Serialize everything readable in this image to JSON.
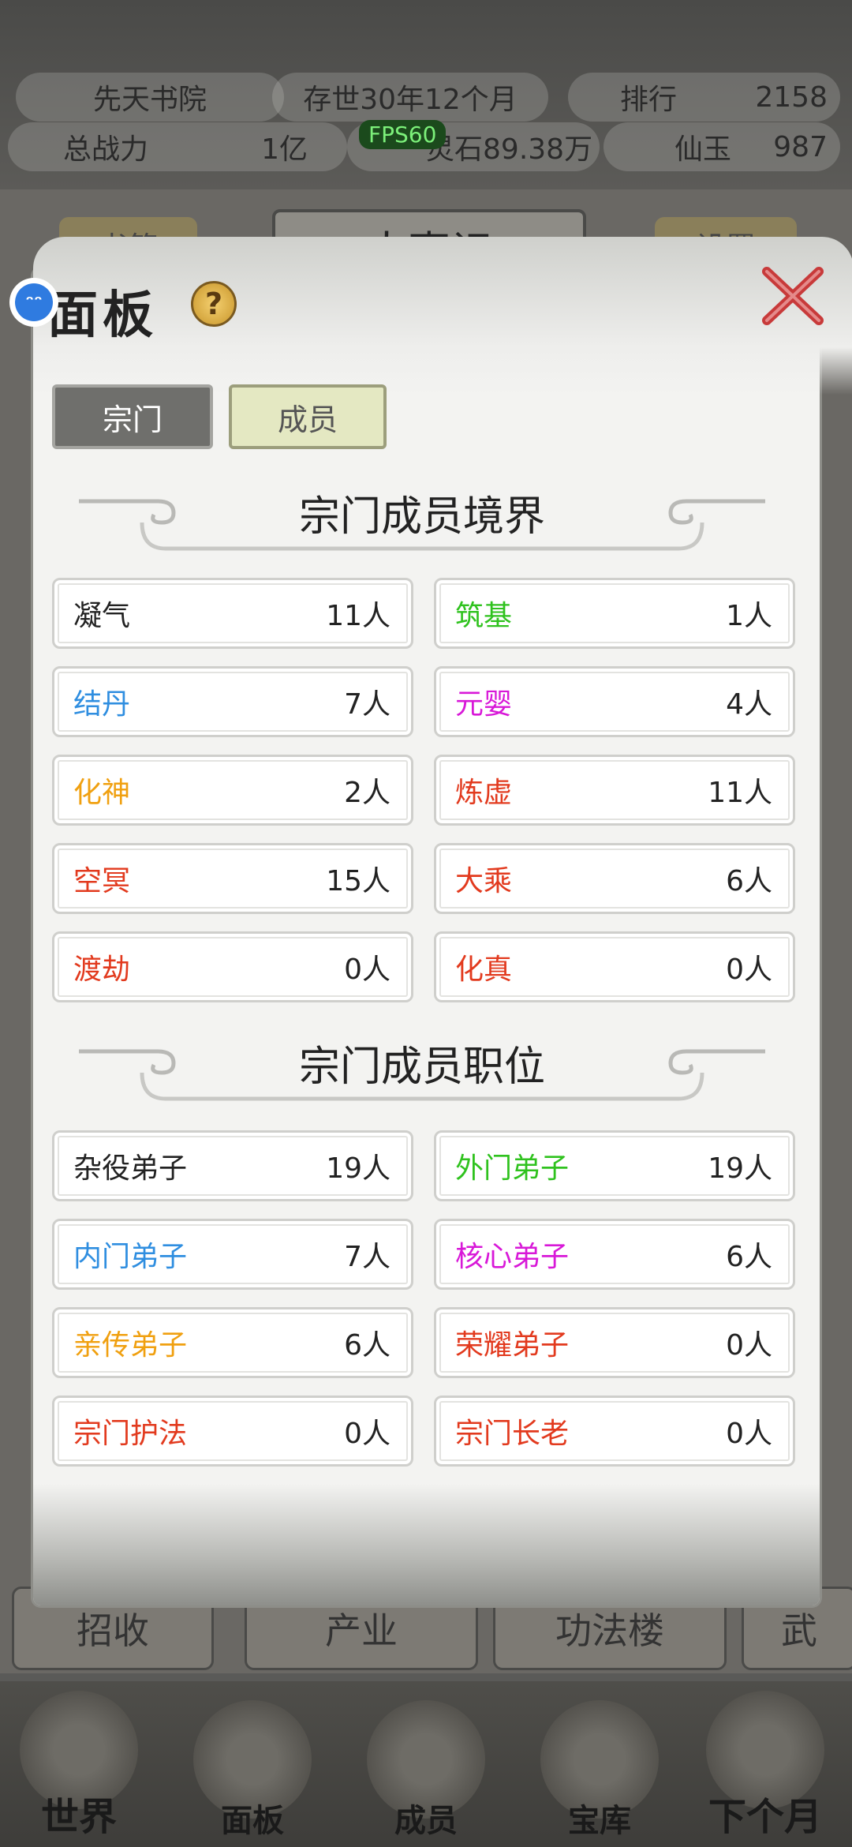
{
  "background": {
    "sect_name": "先天书院",
    "age": "存世30年12个月",
    "rank_label": "排行",
    "rank_value": "2158",
    "power_label": "总战力",
    "power_value": "1亿",
    "spirit_stone_label": "灵石",
    "spirit_stone_value": "89.38万",
    "jade_label": "仙玉",
    "jade_value": "987",
    "left_btn": "书籍",
    "banner": "大事记",
    "settings_btn": "设置",
    "tabs": [
      "招收",
      "产业",
      "功法楼",
      "武"
    ],
    "nav": [
      "世界",
      "面板",
      "成员",
      "宝库",
      "下个月"
    ]
  },
  "fps": "FPS60",
  "float_ball_icon": "ᵔᵔ",
  "panel": {
    "title": "面板",
    "help": "?",
    "tabs": {
      "sect": "宗门",
      "member": "成员"
    },
    "realm_title": "宗门成员境界",
    "realms": [
      {
        "name": "凝气",
        "count": "11人",
        "color": "#222222"
      },
      {
        "name": "筑基",
        "count": "1人",
        "color": "#2fc21e"
      },
      {
        "name": "结丹",
        "count": "7人",
        "color": "#2f8ee0"
      },
      {
        "name": "元婴",
        "count": "4人",
        "color": "#d818d8"
      },
      {
        "name": "化神",
        "count": "2人",
        "color": "#f0a010"
      },
      {
        "name": "炼虚",
        "count": "11人",
        "color": "#e23a1e"
      },
      {
        "name": "空冥",
        "count": "15人",
        "color": "#e23a1e"
      },
      {
        "name": "大乘",
        "count": "6人",
        "color": "#e23a1e"
      },
      {
        "name": "渡劫",
        "count": "0人",
        "color": "#e23a1e"
      },
      {
        "name": "化真",
        "count": "0人",
        "color": "#e23a1e"
      }
    ],
    "position_title": "宗门成员职位",
    "positions": [
      {
        "name": "杂役弟子",
        "count": "19人",
        "color": "#222222"
      },
      {
        "name": "外门弟子",
        "count": "19人",
        "color": "#2fc21e"
      },
      {
        "name": "内门弟子",
        "count": "7人",
        "color": "#2f8ee0"
      },
      {
        "name": "核心弟子",
        "count": "6人",
        "color": "#d818d8"
      },
      {
        "name": "亲传弟子",
        "count": "6人",
        "color": "#f0a010"
      },
      {
        "name": "荣耀弟子",
        "count": "0人",
        "color": "#e23a1e"
      },
      {
        "name": "宗门护法",
        "count": "0人",
        "color": "#e23a1e"
      },
      {
        "name": "宗门长老",
        "count": "0人",
        "color": "#e23a1e"
      }
    ]
  }
}
